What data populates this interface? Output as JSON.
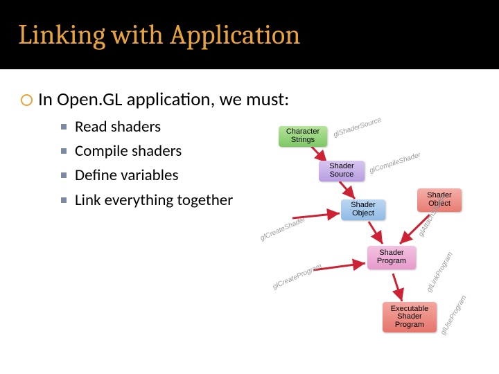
{
  "title": "Linking with Application",
  "lvl1": "In Open.GL application, we must:",
  "bullets": {
    "b0": "Read shaders",
    "b1": "Compile shaders",
    "b2": "Define variables",
    "b3": "Link everything together"
  },
  "diagram": {
    "nodes": {
      "char_strings": "Character\nStrings",
      "shader_source": "Shader\nSource",
      "shader_object1": "Shader\nObject",
      "shader_object2": "Shader\nObject",
      "shader_program": "Shader\nProgram",
      "exe_shader_program": "Executable\nShader\nProgram"
    },
    "edge_labels": {
      "glShaderSource": "glShaderSource",
      "glCompileShader": "glCompileShader",
      "glCreateShader": "glCreateShader",
      "glCreateProgram": "glCreateProgram",
      "glAttachShader": "glAttachShader",
      "glLinkProgram": "glLinkProgram",
      "glUseProgram": "glUseProgram"
    }
  }
}
